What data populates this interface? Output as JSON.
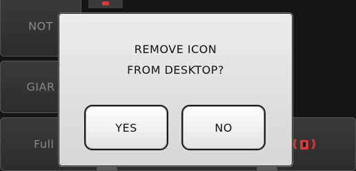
{
  "background": {
    "tiles": [
      "NOT",
      "GIAR",
      "Full"
    ]
  },
  "dialog": {
    "message_line1": "REMOVE ICON",
    "message_line2": "FROM DESKTOP?",
    "yes_label": "YES",
    "no_label": "NO"
  },
  "colors": {
    "accent_red": "#d43a3a",
    "dialog_bg": "#e6e6e6"
  }
}
